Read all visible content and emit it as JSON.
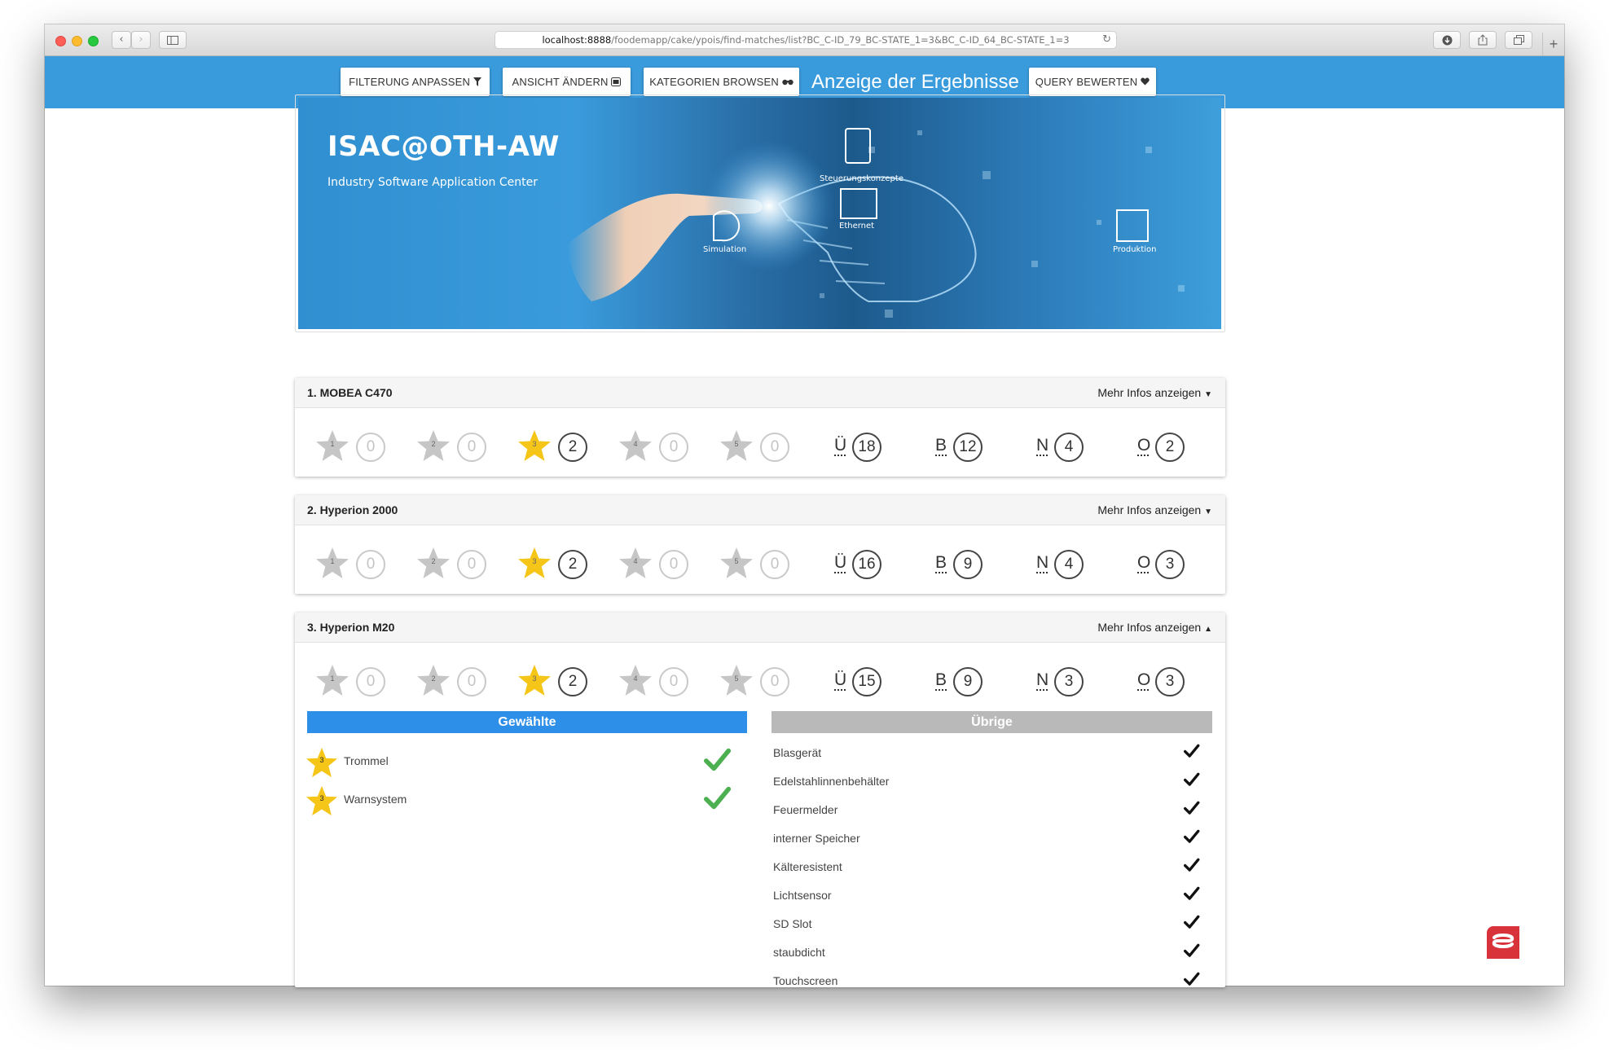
{
  "browser": {
    "url_host": "localhost:8888",
    "url_path": "/foodemapp/cake/ypois/find-matches/list?BC_C-ID_79_BC-STATE_1=3&BC_C-ID_64_BC-STATE_1=3"
  },
  "navbar": {
    "filter_button": "FILTERUNG ANPASSEN",
    "view_button": "ANSICHT ÄNDERN",
    "browse_button": "KATEGORIEN BROWSEN",
    "title": "Anzeige der Ergebnisse",
    "rate_button": "QUERY BEWERTEN"
  },
  "banner": {
    "title": "ISAC@OTH-AW",
    "subtitle": "Industry Software Application Center",
    "labels": [
      "Steuerungskonzepte",
      "Ethernet",
      "Simulation",
      "Produktion"
    ]
  },
  "results": [
    {
      "title": "1. MOBEA C470",
      "more": "Mehr Infos anzeigen",
      "expanded": false,
      "stars": [
        {
          "n": "1",
          "count": "0"
        },
        {
          "n": "2",
          "count": "0"
        },
        {
          "n": "3",
          "count": "2"
        },
        {
          "n": "4",
          "count": "0"
        },
        {
          "n": "5",
          "count": "0"
        }
      ],
      "letters": [
        {
          "l": "Ü",
          "count": "18"
        },
        {
          "l": "B",
          "count": "12"
        },
        {
          "l": "N",
          "count": "4"
        },
        {
          "l": "O",
          "count": "2"
        }
      ]
    },
    {
      "title": "2. Hyperion 2000",
      "more": "Mehr Infos anzeigen",
      "expanded": false,
      "stars": [
        {
          "n": "1",
          "count": "0"
        },
        {
          "n": "2",
          "count": "0"
        },
        {
          "n": "3",
          "count": "2"
        },
        {
          "n": "4",
          "count": "0"
        },
        {
          "n": "5",
          "count": "0"
        }
      ],
      "letters": [
        {
          "l": "Ü",
          "count": "16"
        },
        {
          "l": "B",
          "count": "9"
        },
        {
          "l": "N",
          "count": "4"
        },
        {
          "l": "O",
          "count": "3"
        }
      ]
    },
    {
      "title": "3. Hyperion M20",
      "more": "Mehr Infos anzeigen",
      "expanded": true,
      "stars": [
        {
          "n": "1",
          "count": "0"
        },
        {
          "n": "2",
          "count": "0"
        },
        {
          "n": "3",
          "count": "2"
        },
        {
          "n": "4",
          "count": "0"
        },
        {
          "n": "5",
          "count": "0"
        }
      ],
      "letters": [
        {
          "l": "Ü",
          "count": "15"
        },
        {
          "l": "B",
          "count": "9"
        },
        {
          "l": "N",
          "count": "3"
        },
        {
          "l": "O",
          "count": "3"
        }
      ]
    }
  ],
  "details": {
    "selected_heading": "Gewählte",
    "others_heading": "Übrige",
    "selected": [
      {
        "star": "3",
        "label": "Trommel"
      },
      {
        "star": "3",
        "label": "Warnsystem"
      }
    ],
    "others": [
      "Blasgerät",
      "Edelstahlinnenbehälter",
      "Feuermelder",
      "interner Speicher",
      "Kälteresistent",
      "Lichtsensor",
      "SD Slot",
      "staubdicht",
      "Touchscreen"
    ]
  },
  "colors": {
    "navbar": "#3a9bdc",
    "star_active": "#f5c518",
    "star_inactive": "#c6c6c6",
    "selected_heading_bg": "#2e8fe8",
    "others_heading_bg": "#b9b9b9",
    "check_green": "#4caf50"
  }
}
